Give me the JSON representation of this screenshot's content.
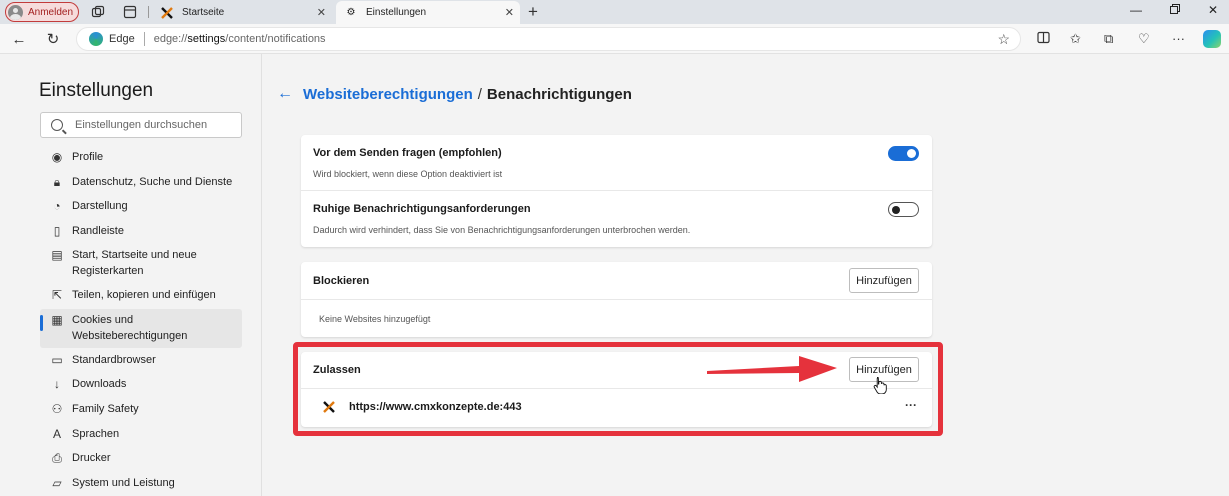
{
  "browser": {
    "signin_label": "Anmelden",
    "tabs": [
      {
        "title": "Startseite",
        "active": false
      },
      {
        "title": "Einstellungen",
        "active": true
      }
    ],
    "address": {
      "edge_label": "Edge",
      "url_prefix": "edge://",
      "url_host": "settings",
      "url_path": "/content/notifications"
    }
  },
  "sidebar": {
    "title": "Einstellungen",
    "search_placeholder": "Einstellungen durchsuchen",
    "items": [
      {
        "label": "Profile",
        "icon": "profile-icon"
      },
      {
        "label": "Datenschutz, Suche und Dienste",
        "icon": "lock-icon"
      },
      {
        "label": "Darstellung",
        "icon": "palette-icon"
      },
      {
        "label": "Randleiste",
        "icon": "sidebar-icon"
      },
      {
        "label": "Start, Startseite und neue Registerkarten",
        "icon": "home-tabs-icon"
      },
      {
        "label": "Teilen, kopieren und einfügen",
        "icon": "share-icon"
      },
      {
        "label": "Cookies und Websiteberechtigungen",
        "icon": "cookie-icon",
        "selected": true
      },
      {
        "label": "Standardbrowser",
        "icon": "browser-icon"
      },
      {
        "label": "Downloads",
        "icon": "download-icon"
      },
      {
        "label": "Family Safety",
        "icon": "family-icon"
      },
      {
        "label": "Sprachen",
        "icon": "language-icon"
      },
      {
        "label": "Drucker",
        "icon": "printer-icon"
      },
      {
        "label": "System und Leistung",
        "icon": "laptop-icon"
      }
    ]
  },
  "breadcrumb": {
    "parent": "Websiteberechtigungen",
    "separator": "/",
    "current": "Benachrichtigungen"
  },
  "settings": {
    "ask_before_sending": {
      "title": "Vor dem Senden fragen (empfohlen)",
      "desc": "Wird blockiert, wenn diese Option deaktiviert ist",
      "enabled": true
    },
    "quiet_requests": {
      "title": "Ruhige Benachrichtigungsanforderungen",
      "desc": "Dadurch wird verhindert, dass Sie von Benachrichtigungsanforderungen unterbrochen werden.",
      "enabled": false
    }
  },
  "block_section": {
    "title": "Blockieren",
    "add_label": "Hinzufügen",
    "empty_text": "Keine Websites hinzugefügt"
  },
  "allow_section": {
    "title": "Zulassen",
    "add_label": "Hinzufügen",
    "sites": [
      {
        "url": "https://www.cmxkonzepte.de:443",
        "more": "···"
      }
    ]
  },
  "colors": {
    "accent": "#1a6dd6",
    "highlight": "#e5323c"
  }
}
